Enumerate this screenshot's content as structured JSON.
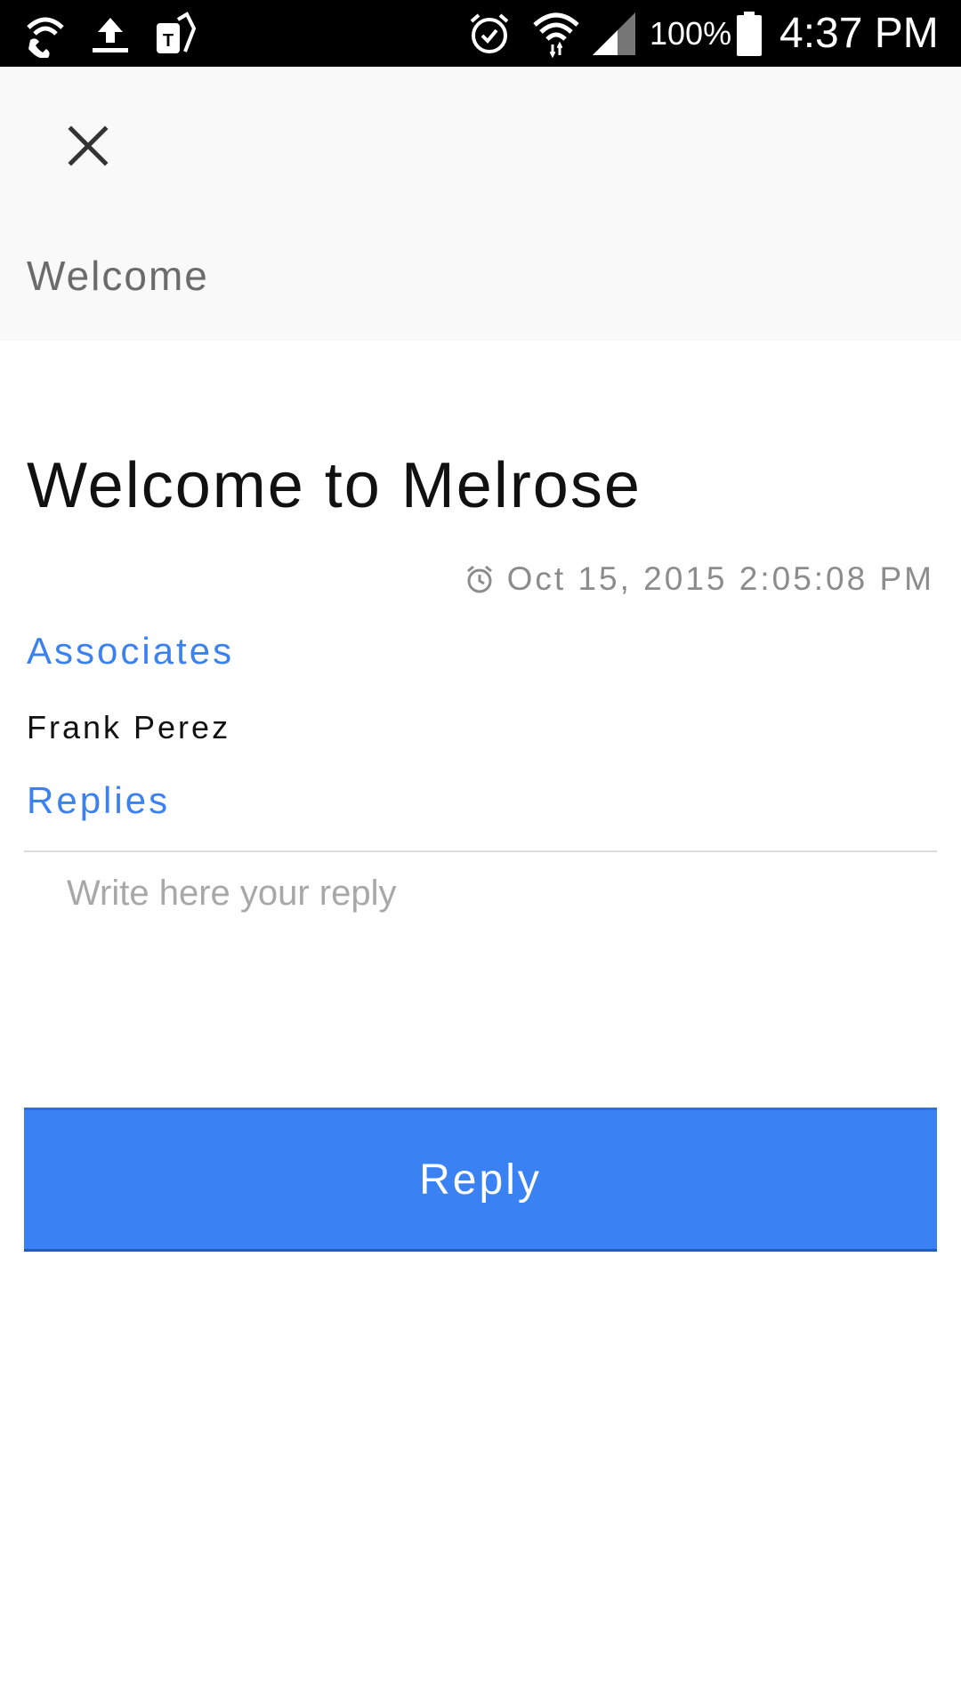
{
  "status_bar": {
    "icons_left": [
      "wifi-calling-icon",
      "upload-icon",
      "tmobile-icon"
    ],
    "icons_right": [
      "alarm-icon",
      "wifi-icon",
      "signal-icon",
      "battery-icon"
    ],
    "battery_percent": "100%",
    "time": "4:37 PM"
  },
  "header": {
    "close_icon": "close-icon",
    "title": "Welcome"
  },
  "message": {
    "title": "Welcome to Melrose",
    "timestamp_icon": "alarm-clock-icon",
    "timestamp": "Oct 15, 2015 2:05:08 PM",
    "associates_label": "Associates",
    "associates": [
      "Frank Perez"
    ],
    "replies_label": "Replies"
  },
  "reply": {
    "placeholder": "Write here your reply",
    "value": "",
    "button_label": "Reply"
  },
  "colors": {
    "accent": "#3a82f3",
    "header_bg": "#f9f9f9",
    "status_bar_bg": "#000000"
  }
}
